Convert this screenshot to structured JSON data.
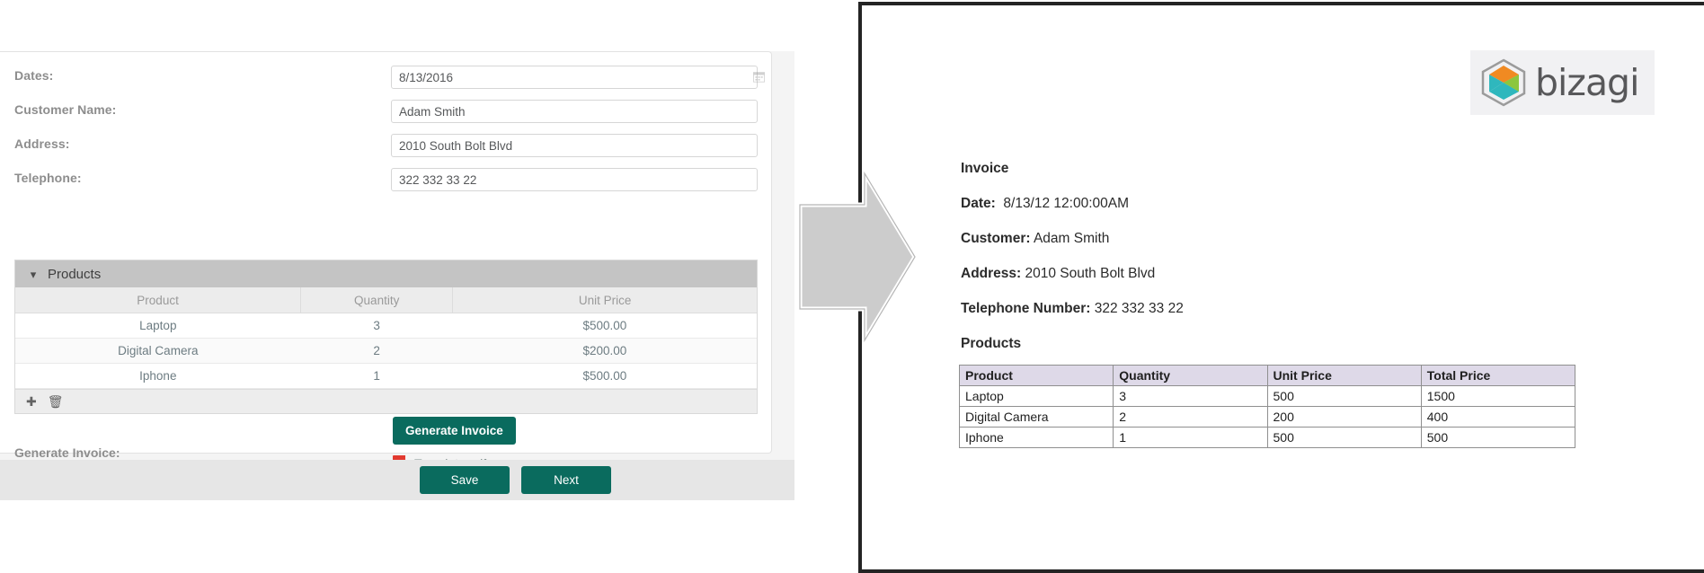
{
  "form": {
    "fields": [
      {
        "label": "Dates:",
        "value": "8/13/2016",
        "icon": "calendar-icon",
        "name": "dates"
      },
      {
        "label": "Customer Name:",
        "value": "Adam Smith",
        "name": "customer-name"
      },
      {
        "label": "Address:",
        "value": "2010 South Bolt Blvd",
        "name": "address"
      },
      {
        "label": "Telephone:",
        "value": "322 332 33 22",
        "name": "telephone"
      }
    ],
    "products_group": {
      "title": "Products",
      "collapse_icon": "chevron-down-icon",
      "columns": [
        "Product",
        "Quantity",
        "Unit Price"
      ],
      "rows": [
        {
          "product": "Laptop",
          "quantity": "3",
          "unit_price": "$500.00"
        },
        {
          "product": "Digital Camera",
          "quantity": "2",
          "unit_price": "$200.00"
        },
        {
          "product": "Iphone",
          "quantity": "1",
          "unit_price": "$500.00"
        }
      ],
      "toolbar": {
        "add_icon": "plus-icon",
        "delete_icon": "trash-icon"
      }
    },
    "generate_label": "Generate Invoice:",
    "generate_button": "Generate Invoice",
    "attachment": {
      "name": "Template.pdf",
      "icon": "pdf-file-icon"
    },
    "actions": {
      "save": "Save",
      "next": "Next"
    },
    "accent_color": "#0a6b5e"
  },
  "arrow": {
    "icon": "right-arrow-icon",
    "color": "#cccccc"
  },
  "document": {
    "logo": {
      "icon": "bizagi-hexagon-icon",
      "wordmark": "bizagi"
    },
    "title": "Invoice",
    "lines": [
      {
        "label": "Date:",
        "value": "8/13/12 12:00:00AM",
        "name": "doc-date"
      },
      {
        "label": "Customer:",
        "value": "Adam Smith",
        "name": "doc-customer"
      },
      {
        "label": "Address:",
        "value": "2010 South Bolt Blvd",
        "name": "doc-address"
      },
      {
        "label": "Telephone Number:",
        "value": "322 332 33 22",
        "name": "doc-telephone"
      }
    ],
    "products_heading": "Products",
    "table": {
      "columns": [
        "Product",
        "Quantity",
        "Unit Price",
        "Total Price"
      ],
      "rows": [
        {
          "product": "Laptop",
          "quantity": "3",
          "unit_price": "500",
          "total_price": "1500"
        },
        {
          "product": "Digital Camera",
          "quantity": "2",
          "unit_price": "200",
          "total_price": "400"
        },
        {
          "product": "Iphone",
          "quantity": "1",
          "unit_price": "500",
          "total_price": "500"
        }
      ],
      "header_color": "#ded9e8"
    }
  }
}
